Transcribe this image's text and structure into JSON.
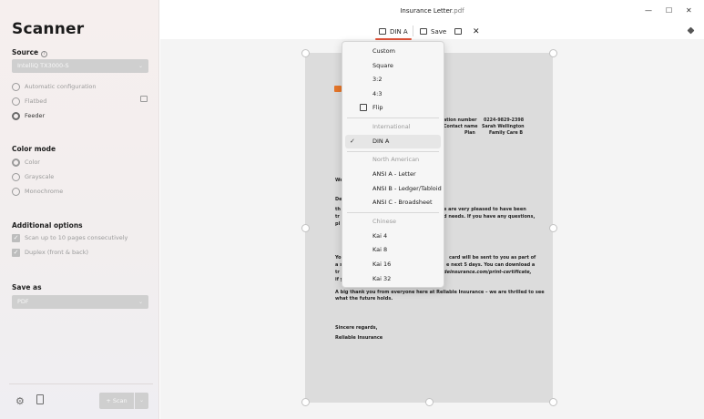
{
  "window": {
    "title_name": "Insurance Letter",
    "title_ext": ".pdf",
    "controls": {
      "minimize": "—",
      "maximize": "☐",
      "close": "✕"
    }
  },
  "sidebar": {
    "app_title": "Scanner",
    "source": {
      "label": "Source",
      "selected": "IntelliQ TX3000-S",
      "options": [
        "Automatic configuration",
        "Flatbed",
        "Feeder"
      ],
      "checked": "Feeder"
    },
    "color_mode": {
      "label": "Color mode",
      "options": [
        "Color",
        "Grayscale",
        "Monochrome"
      ],
      "checked": "Color"
    },
    "additional": {
      "label": "Additional options",
      "items": [
        "Scan up to 10 pages consecutively",
        "Duplex (front & back)"
      ]
    },
    "save_as": {
      "label": "Save as",
      "selected": "PDF"
    },
    "scan_label": "+ Scan"
  },
  "toolbar": {
    "din_label": "DIN A",
    "save_label": "Save"
  },
  "document": {
    "fields": [
      {
        "k": "ation number",
        "v": "0224-9829-2398"
      },
      {
        "k": "Contact name",
        "v": "Sarah Wellington"
      },
      {
        "k": "Plan",
        "v": "Family Care B"
      }
    ],
    "greeting": "We",
    "line_de": "De",
    "para1": [
      "th",
      "tr",
      "pl"
    ],
    "para1_right": [
      "e are very pleased to have been",
      "d needs. If you have any questions,",
      ""
    ],
    "para2_left": [
      "Yo",
      "a s",
      "tr",
      "if y"
    ],
    "para2_right": [
      "card will be sent to you as part of",
      "e next 5 days. You can download a",
      "deinsurance.com/print-certificate,",
      ""
    ],
    "thanks_1": "A big thank you from everyone here at Reliable Insurance – we are thrilled to see",
    "thanks_2": "what the future holds.",
    "regards": "Sincere regards,",
    "signoff": "Reliable Insurance"
  },
  "menu": {
    "items": [
      {
        "label": "Custom",
        "type": "item"
      },
      {
        "label": "Square",
        "type": "item"
      },
      {
        "label": "3:2",
        "type": "item"
      },
      {
        "label": "4:3",
        "type": "item"
      },
      {
        "label": "Flip",
        "type": "item"
      },
      {
        "label": "International",
        "type": "header"
      },
      {
        "label": "DIN A",
        "type": "selected"
      },
      {
        "label": "North American",
        "type": "header"
      },
      {
        "label": "ANSI A - Letter",
        "type": "item"
      },
      {
        "label": "ANSI B - Ledger/Tabloid",
        "type": "item"
      },
      {
        "label": "ANSI C - Broadsheet",
        "type": "item"
      },
      {
        "label": "Chinese",
        "type": "header"
      },
      {
        "label": "Kai 4",
        "type": "item"
      },
      {
        "label": "Kai 8",
        "type": "item"
      },
      {
        "label": "Kai 16",
        "type": "item"
      },
      {
        "label": "Kai 32",
        "type": "item"
      }
    ]
  }
}
